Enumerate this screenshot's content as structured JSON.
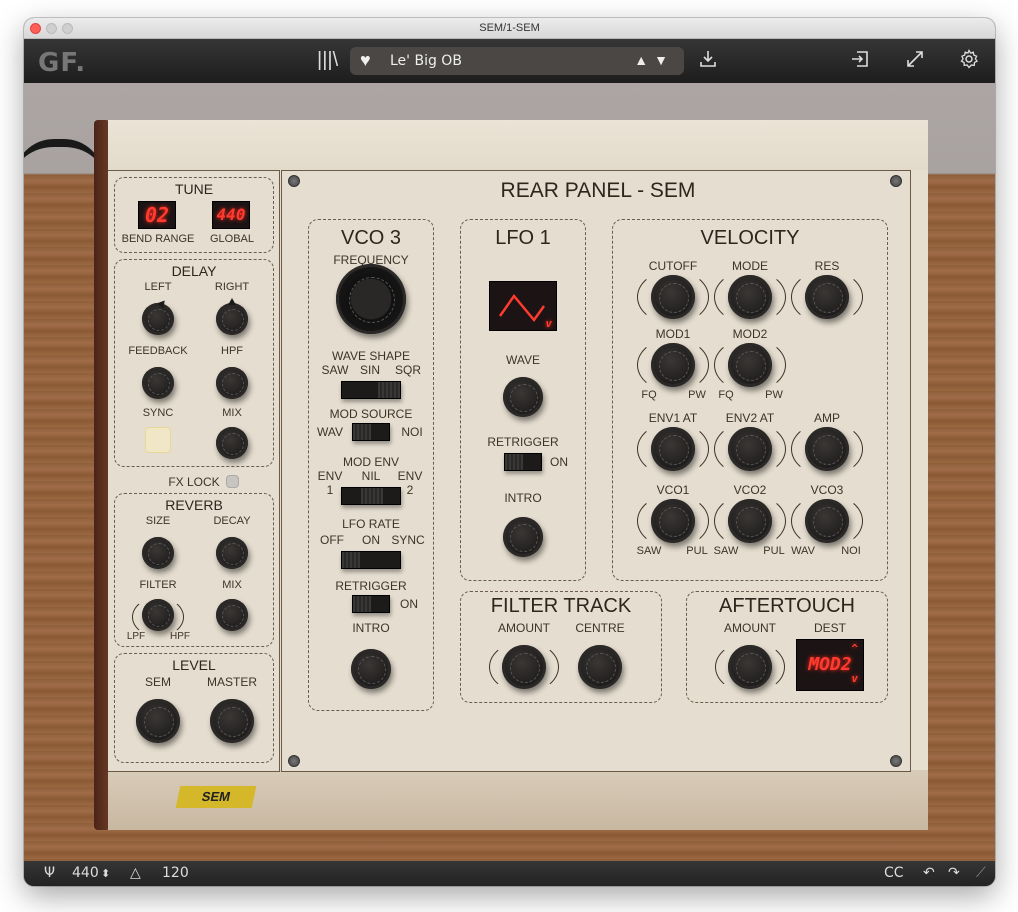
{
  "window": {
    "title": "SEM/1-SEM"
  },
  "toolbar": {
    "logo": "GF.",
    "library_icon": "library-icon",
    "favorite_icon": "heart-icon",
    "preset_name": "Le' Big OB",
    "prev_next": "▲ ▼",
    "save_icon": "download-icon",
    "export_icon": "export-icon",
    "fullscreen_icon": "expand-icon",
    "settings_icon": "gear-icon"
  },
  "panel": {
    "title": "REAR PANEL - SEM",
    "sticker": "SEM"
  },
  "tune": {
    "title": "TUNE",
    "bend_range_value": "02",
    "bend_range_label": "BEND RANGE",
    "global_value": "440",
    "global_label": "GLOBAL"
  },
  "delay": {
    "title": "DELAY",
    "left": "LEFT",
    "right": "RIGHT",
    "feedback": "FEEDBACK",
    "hpf": "HPF",
    "sync": "SYNC",
    "mix": "MIX"
  },
  "fx_lock": {
    "label": "FX LOCK"
  },
  "reverb": {
    "title": "REVERB",
    "size": "SIZE",
    "decay": "DECAY",
    "filter": "FILTER",
    "filter_min": "LPF",
    "filter_max": "HPF",
    "mix": "MIX"
  },
  "level": {
    "title": "LEVEL",
    "sem": "SEM",
    "master": "MASTER"
  },
  "vco3": {
    "title": "VCO 3",
    "frequency": "FREQUENCY",
    "wave_shape": "WAVE SHAPE",
    "wave_options": [
      "SAW",
      "SIN",
      "SQR"
    ],
    "mod_source": "MOD SOURCE",
    "mod_source_left": "WAV",
    "mod_source_right": "NOI",
    "mod_env": "MOD ENV",
    "mod_env_options": [
      "ENV",
      "NIL",
      "ENV"
    ],
    "mod_env_nums": [
      "1",
      "2"
    ],
    "lfo_rate": "LFO RATE",
    "lfo_rate_options": [
      "OFF",
      "ON",
      "SYNC"
    ],
    "retrigger": "RETRIGGER",
    "retrigger_on": "ON",
    "intro": "INTRO"
  },
  "lfo1": {
    "title": "LFO 1",
    "wave": "WAVE",
    "wave_display_arrow": "v",
    "retrigger": "RETRIGGER",
    "retrigger_on": "ON",
    "intro": "INTRO"
  },
  "velocity": {
    "title": "VELOCITY",
    "knobs": [
      {
        "label": "CUTOFF"
      },
      {
        "label": "MODE"
      },
      {
        "label": "RES"
      },
      {
        "label": "MOD1",
        "min": "FQ",
        "max": "PW"
      },
      {
        "label": "MOD2",
        "min": "FQ",
        "max": "PW"
      },
      {
        "label": "ENV1 AT"
      },
      {
        "label": "ENV2 AT"
      },
      {
        "label": "AMP"
      },
      {
        "label": "VCO1",
        "min": "SAW",
        "max": "PUL"
      },
      {
        "label": "VCO2",
        "min": "SAW",
        "max": "PUL"
      },
      {
        "label": "VCO3",
        "min": "WAV",
        "max": "NOI"
      }
    ]
  },
  "filter_track": {
    "title": "FILTER TRACK",
    "amount": "AMOUNT",
    "centre": "CENTRE"
  },
  "aftertouch": {
    "title": "AFTERTOUCH",
    "amount": "AMOUNT",
    "dest": "DEST",
    "dest_value": "MOD2",
    "up": "^",
    "down": "v"
  },
  "statusbar": {
    "tuning_icon": "tuning-fork-icon",
    "tuning_value": "440",
    "tuning_stepper": "⬍",
    "tempo_icon": "metronome-icon",
    "tempo_value": "120",
    "cc_label": "CC",
    "undo_icon": "undo-icon",
    "redo_icon": "redo-icon"
  }
}
